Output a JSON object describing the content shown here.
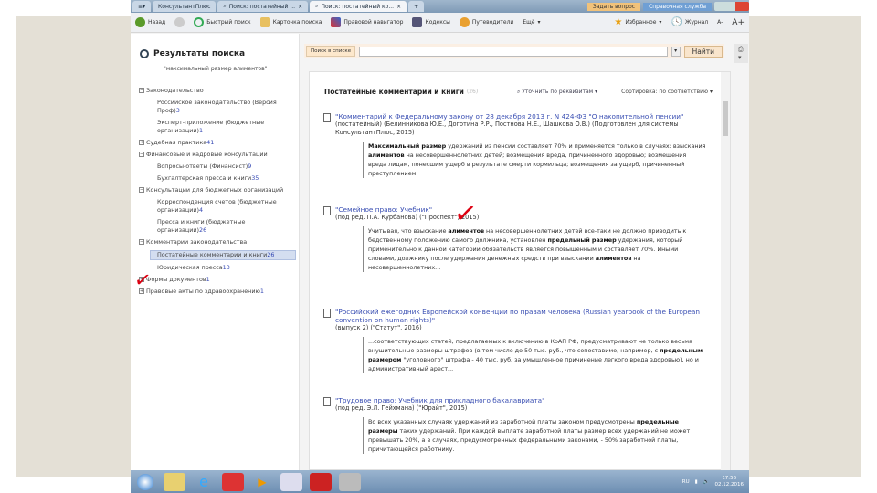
{
  "window": {
    "tabs": [
      "КонсультантПлюс",
      "Поиск: постатейный ...",
      "Поиск: постатейный ко..."
    ],
    "ask_label": "Задать вопрос",
    "user_label": "Справочная служба"
  },
  "toolbar": {
    "back": "Назад",
    "quick_search": "Быстрый поиск",
    "cards": "Карточка поиска",
    "navigator": "Правовой навигатор",
    "codes": "Кодексы",
    "guides": "Путеводители",
    "more": "Ещё",
    "favorites": "Избранное",
    "journal": "Журнал",
    "font_minus": "A-",
    "font_plus": "A+"
  },
  "left": {
    "title": "Результаты поиска",
    "query": "\"максимальный размер алиментов\"",
    "tree": [
      {
        "label": "Законодательство",
        "box": "−",
        "count": "",
        "level": 0
      },
      {
        "label": "Российское законодательство (Версия Проф)",
        "count": "3",
        "level": 1
      },
      {
        "label": "Эксперт-приложение (бюджетные организации)",
        "count": "1",
        "level": 1
      },
      {
        "label": "Судебная практика",
        "box": "+",
        "count": "41",
        "level": 0
      },
      {
        "label": "Финансовые и кадровые консультации",
        "box": "−",
        "count": "",
        "level": 0
      },
      {
        "label": "Вопросы-ответы (Финансист)",
        "count": "9",
        "level": 1
      },
      {
        "label": "Бухгалтерская пресса и книги",
        "count": "35",
        "level": 1
      },
      {
        "label": "Консультации для бюджетных организаций",
        "box": "−",
        "count": "",
        "level": 0
      },
      {
        "label": "Корреспонденция счетов (бюджетные организации)",
        "count": "4",
        "level": 1
      },
      {
        "label": "Пресса и книги (бюджетные организации)",
        "count": "26",
        "level": 1
      },
      {
        "label": "Комментарии законодательства",
        "box": "−",
        "count": "",
        "level": 0
      },
      {
        "label": "Постатейные комментарии и книги",
        "count": "26",
        "level": 1,
        "selected": true
      },
      {
        "label": "Юридическая пресса",
        "count": "13",
        "level": 1
      },
      {
        "label": "Формы документов",
        "box": "+",
        "count": "1",
        "level": 0
      },
      {
        "label": "Правовые акты по здравоохранению",
        "box": "+",
        "count": "1",
        "level": 0
      }
    ]
  },
  "search": {
    "label": "Поиск в списке",
    "value": "",
    "button": "Найти",
    "w_button": "W",
    "more_button": "•••"
  },
  "main": {
    "title": "Постатейные комментарии и книги",
    "count": "(26)",
    "filter": "Уточнить по реквизитам ▾",
    "sort": "Сортировка: по соответствию ▾",
    "results": [
      {
        "title": "\"Комментарий к Федеральному закону от 28 декабря 2013 г. N 424-ФЗ \"О накопительной пенсии\"",
        "meta": "(постатейный) (Белинникова Ю.Е., Доготина Р.Р., Постнова Н.Е., Шашкова О.В.) (Подготовлен для системы КонсультантПлюс, 2015)",
        "snippet": [
          {
            "b": "Максимальный размер"
          },
          {
            "t": " удержаний из пенсии составляет 70% и применяется только в случаях: взыскания "
          },
          {
            "b": "алиментов"
          },
          {
            "t": " на несовершеннолетних детей; возмещения вреда, причиненного здоровью; возмещения вреда лицам, понесшим ущерб в результате смерти кормильца; возмещения за ущерб, причиненный преступлением."
          }
        ]
      },
      {
        "title": "\"Семейное право: Учебник\"",
        "meta": "(под ред. П.А. Курбанова) (\"Проспект\", 2015)",
        "snippet": [
          {
            "t": "Учитывая, что взыскание "
          },
          {
            "b": "алиментов"
          },
          {
            "t": " на несовершеннолетних детей все-таки не должно приводить к бедственному положению самого должника, установлен "
          },
          {
            "b": "предельный размер"
          },
          {
            "t": " удержания, который применительно к данной категории обязательств является повышенным и составляет 70%. Иными словами, должнику после удержания денежных средств при взыскании "
          },
          {
            "b": "алиментов"
          },
          {
            "t": " на несовершеннолетних..."
          }
        ]
      },
      {
        "title": "\"Российский ежегодник Европейской конвенции по правам человека (Russian yearbook of the European convention on human rights)\"",
        "meta": "(выпуск 2) (\"Статут\", 2016)",
        "snippet": [
          {
            "t": "...соответствующих статей, предлагаемых к включению в КоАП РФ, предусматривают не только весьма внушительные размеры штрафов (в том числе до 50 тыс. руб., что сопоставимо, например, с "
          },
          {
            "b": "предельным размером"
          },
          {
            "t": " \"уголовного\" штрафа - 40 тыс. руб. за умышленное причинение легкого вреда здоровью), но и административный арест..."
          }
        ]
      },
      {
        "title": "\"Трудовое право: Учебник для прикладного бакалавриата\"",
        "meta": "(под ред. Э.Л. Гейхмана) (\"Юрайт\", 2015)",
        "snippet": [
          {
            "t": "Во всех указанных случаях удержаний из заработной платы законом предусмотрены "
          },
          {
            "b": "предельные размеры"
          },
          {
            "t": " таких удержаний. При каждой выплате заработной платы размер всех удержаний не может превышать 20%, а в случаях, предусмотренных федеральными законами, - 50% заработной платы, причитающейся работнику."
          }
        ]
      }
    ]
  },
  "taskbar": {
    "lang": "RU",
    "time": "17:56",
    "date": "02.12.2016"
  }
}
